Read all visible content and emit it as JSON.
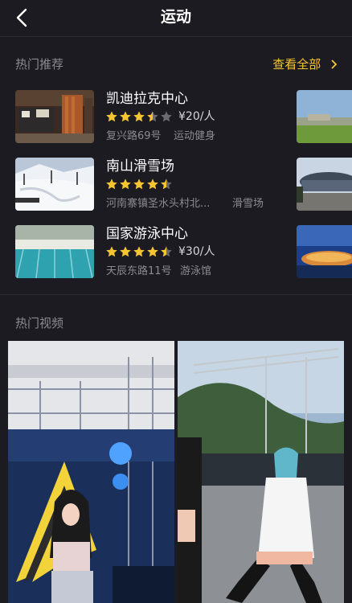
{
  "nav": {
    "title": "运动",
    "back_icon": "chevron-left-icon"
  },
  "hot_recommend": {
    "title": "热门推荐",
    "see_all": "查看全部",
    "items": [
      {
        "name": "凯迪拉克中心",
        "rating": 3.5,
        "price": "¥20/人",
        "address": "复兴路69号",
        "category": "运动健身"
      },
      {
        "name": "南山滑雪场",
        "rating": 4.5,
        "price": "",
        "address": "河南寨镇圣水头村北...",
        "category": "滑雪场"
      },
      {
        "name": "国家游泳中心",
        "rating": 4.5,
        "price": "¥30/人",
        "address": "天辰东路11号",
        "category": "游泳馆"
      }
    ]
  },
  "hot_videos": {
    "title": "热门视频"
  },
  "colors": {
    "background": "#1c1b21",
    "accent": "#f6c531",
    "secondary_text": "#8c8b92",
    "star_empty": "#6b6a70"
  }
}
